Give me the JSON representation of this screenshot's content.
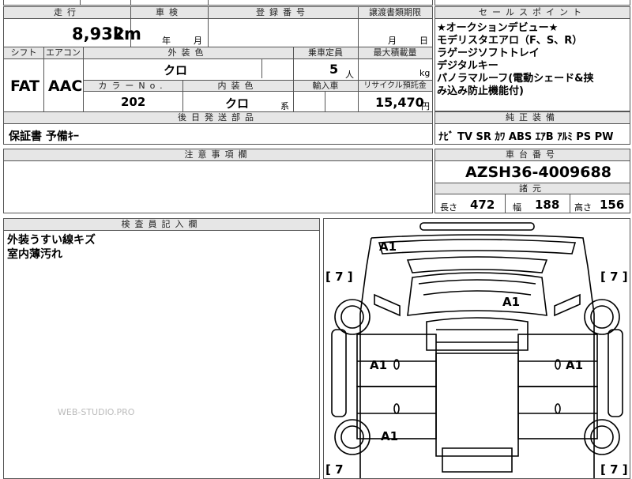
{
  "headers": {
    "mileage": "走行",
    "inspection": "車検",
    "registration": "登録番号",
    "transfer_deadline": "譲渡書類期限",
    "sales_points": "セールスポイント",
    "shift": "シフト",
    "aircon": "エアコン",
    "exterior_color": "外装色",
    "capacity": "乗車定員",
    "max_load": "最大積載量",
    "color_no": "カラーNo.",
    "interior_color": "内装色",
    "import": "輸入車",
    "recycle": "リサイクル預託金",
    "later_parts": "後日発送部品",
    "genuine_equipment": "純正装備",
    "notes": "注意事項欄",
    "chassis_no": "車台番号",
    "specs": "諸元",
    "inspector_notes": "検査員記入欄"
  },
  "vehicle": {
    "mileage_value": "8,932",
    "mileage_unit": "km",
    "inspection_year_unit": "年",
    "inspection_month_unit": "月",
    "transfer_month_unit": "月",
    "transfer_day_unit": "日",
    "shift": "FAT",
    "aircon": "AAC",
    "exterior_color": "クロ",
    "capacity": "5",
    "capacity_unit": "人",
    "max_load_unit": "kg",
    "color_no": "202",
    "interior_color": "クロ",
    "interior_suffix": "系",
    "recycle_fee": "15,470",
    "recycle_unit": "円",
    "later_parts": "保証書 予備ｷｰ",
    "equipment": "ﾅﾋﾞ TV SR ｶﾜ ABS ｴｱB ｱﾙﾐ PS PW",
    "chassis_no": "AZSH36-4009688",
    "length_label": "長さ",
    "length": "472",
    "width_label": "幅",
    "width": "188",
    "height_label": "高さ",
    "height": "156"
  },
  "sales_points": [
    "★オークションデビュー★",
    "モデリスタエアロ（F、S、R）",
    "ラゲージソフトトレイ",
    "デジタルキー",
    "パノラマルーフ(電動シェード&挟",
    "み込み防止機能付)"
  ],
  "inspector_lines": [
    "外装うすい線キズ",
    "室内薄汚れ"
  ],
  "diagram": {
    "marks": [
      "A1",
      "A1",
      "A1",
      "A1",
      "A1"
    ],
    "tires": [
      "[ 7 ]",
      "[ 7 ]",
      "[ 7",
      "[ 7 ]"
    ]
  },
  "watermark": "WEB-STUDIO.PRO"
}
